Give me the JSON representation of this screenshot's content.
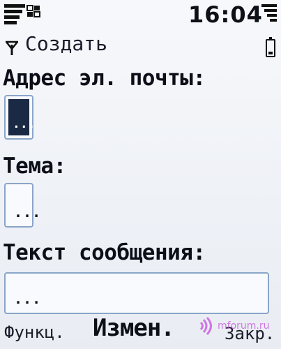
{
  "status": {
    "time": "16:04"
  },
  "header": {
    "title": "Создать"
  },
  "form": {
    "email_label": "Адрес эл. почты:",
    "email_value": "...",
    "subject_label": "Тема:",
    "subject_value": "...",
    "body_label": "Текст сообщения:",
    "body_value": "..."
  },
  "softkeys": {
    "left": "Функц.",
    "middle": "Измен.",
    "right": "Закр."
  },
  "watermark": {
    "text": "mforum.ru"
  },
  "icons": {
    "signal": "signal-strength-icon",
    "network": "network-indicator-icon",
    "battery": "battery-icon",
    "antenna": "antenna-icon",
    "watermark": "radio-waves-icon"
  },
  "colors": {
    "field_border": "#8aa5c8",
    "field_active": "#1b2a44",
    "background": "#f2f4f8"
  }
}
